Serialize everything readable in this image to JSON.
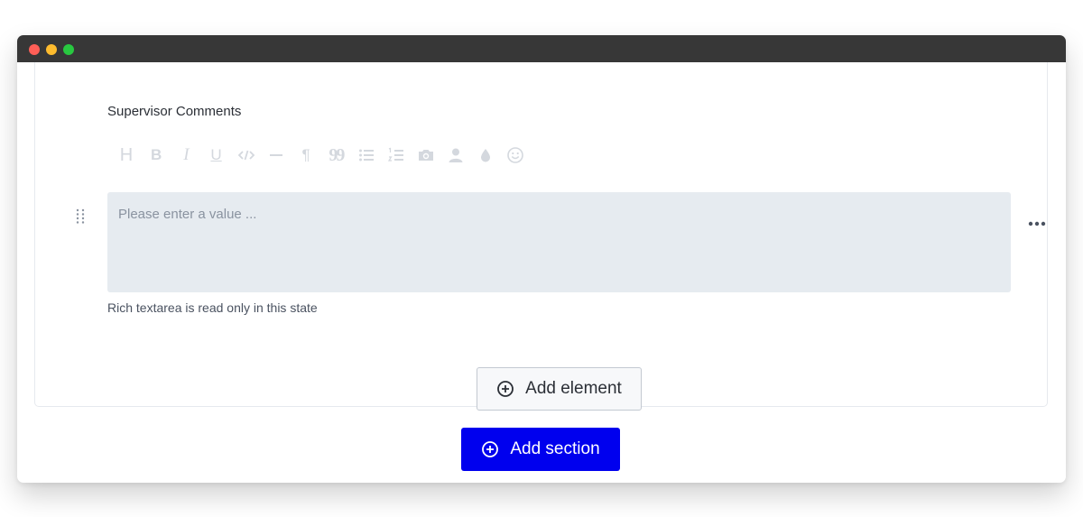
{
  "window": {
    "traffic_lights": [
      "close",
      "minimize",
      "zoom"
    ]
  },
  "field": {
    "label": "Supervisor Comments",
    "placeholder": "Please enter a value ...",
    "help_text": "Rich textarea is read only in this state"
  },
  "toolbar": {
    "buttons": [
      {
        "name": "heading",
        "glyph": "H"
      },
      {
        "name": "bold",
        "glyph": "B"
      },
      {
        "name": "italic",
        "glyph": "I"
      },
      {
        "name": "underline",
        "glyph": "U"
      },
      {
        "name": "code-icon"
      },
      {
        "name": "horizontal-rule-icon"
      },
      {
        "name": "paragraph",
        "glyph": "¶"
      },
      {
        "name": "quote",
        "glyph": "99"
      },
      {
        "name": "bullet-list-icon"
      },
      {
        "name": "numbered-list-icon"
      },
      {
        "name": "camera-icon"
      },
      {
        "name": "user-icon"
      },
      {
        "name": "drop-icon"
      },
      {
        "name": "smiley-icon"
      }
    ]
  },
  "actions": {
    "add_element": "Add element",
    "add_section": "Add section"
  },
  "colors": {
    "primary": "#0000ee",
    "textarea_bg": "#e6ebf0",
    "toolbar_icon": "#d4d8de",
    "titlebar": "#373737"
  }
}
